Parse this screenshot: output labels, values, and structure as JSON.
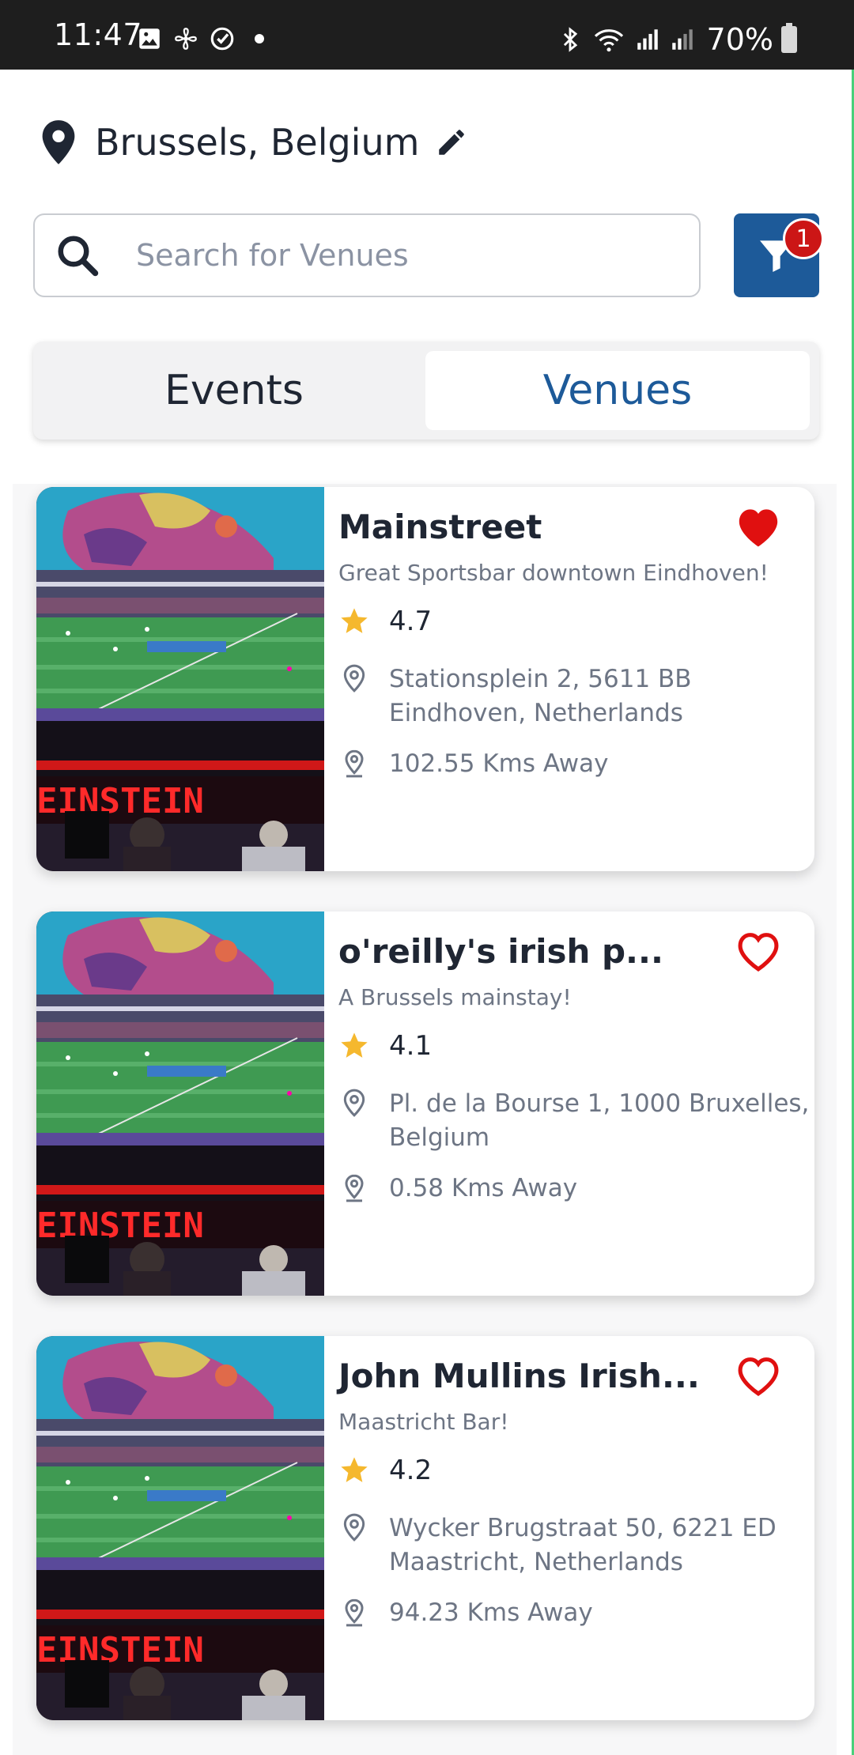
{
  "status_bar": {
    "time": "11:47",
    "battery": "70%",
    "left_icons": [
      "gallery-icon",
      "fan-icon",
      "check-circle-icon",
      "dot-icon"
    ],
    "right_icons": [
      "bluetooth-icon",
      "wifi-icon",
      "signal-icon",
      "signal-icon",
      "battery-icon"
    ]
  },
  "location": {
    "text": "Brussels, Belgium",
    "icon": "map-pin-icon",
    "edit_icon": "pencil-icon"
  },
  "search": {
    "placeholder": "Search for Venues",
    "value": ""
  },
  "filter": {
    "badge_count": "1",
    "icon": "filter-icon"
  },
  "tabs": {
    "events": "Events",
    "venues": "Venues",
    "active": "venues"
  },
  "colors": {
    "brand": "#1d5a99",
    "heart": "#e01010",
    "badge": "#cc1616",
    "star": "#f5b82e"
  },
  "venues": [
    {
      "name": "Mainstreet",
      "subtitle": "Great Sportsbar downtown Eindhoven!",
      "rating": "4.7",
      "address": "Stationsplein 2, 5611 BB Eindhoven, Netherlands",
      "distance": "102.55 Kms Away",
      "favorite": true
    },
    {
      "name": "o'reilly's irish p...",
      "subtitle": "A Brussels mainstay!",
      "rating": "4.1",
      "address": "Pl. de la Bourse 1, 1000 Bruxelles, Belgium",
      "distance": "0.58 Kms Away",
      "favorite": false
    },
    {
      "name": "John Mullins Irish...",
      "subtitle": "Maastricht Bar!",
      "rating": "4.2",
      "address": "Wycker Brugstraat 50, 6221 ED Maastricht, Netherlands",
      "distance": "94.23 Kms Away",
      "favorite": false
    }
  ]
}
